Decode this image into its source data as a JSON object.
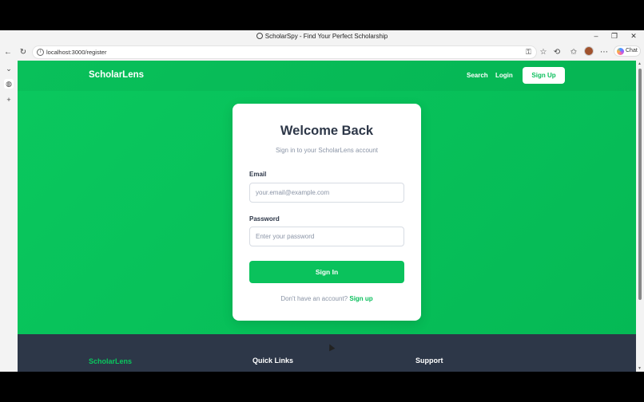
{
  "window": {
    "title": "ScholarSpy - Find Your Perfect Scholarship",
    "controls": {
      "minimize": "–",
      "restore": "❐",
      "close": "✕"
    }
  },
  "toolbar": {
    "url": "localhost:3000/register",
    "icons": [
      "back-arrow-icon",
      "refresh-icon",
      "info-icon",
      "key-icon",
      "star-icon",
      "extensions-icon",
      "favorites-icon",
      "more-icon"
    ],
    "chat_label": "Chat"
  },
  "vertical_tabs": {
    "icons": [
      "chevron-down-icon",
      "globe-icon",
      "plus-icon"
    ]
  },
  "nav": {
    "brand": "ScholarLens",
    "links": [
      "Search",
      "Login"
    ],
    "signup_label": "Sign Up"
  },
  "login_card": {
    "title": "Welcome Back",
    "subtitle": "Sign in to your ScholarLens account",
    "email_label": "Email",
    "email_placeholder": "your.email@example.com",
    "email_value": "",
    "password_label": "Password",
    "password_placeholder": "Enter your password",
    "password_value": "",
    "submit_label": "Sign In",
    "no_account_text": "Don't have an account?",
    "signup_link": "Sign up"
  },
  "footer": {
    "brand": "ScholarLens",
    "headings": [
      "Quick Links",
      "Support"
    ]
  },
  "colors": {
    "primary": "#0ac85e",
    "footer_bg": "#2d3748",
    "heading_text": "#2d3748",
    "muted_text": "#8a94a6"
  }
}
